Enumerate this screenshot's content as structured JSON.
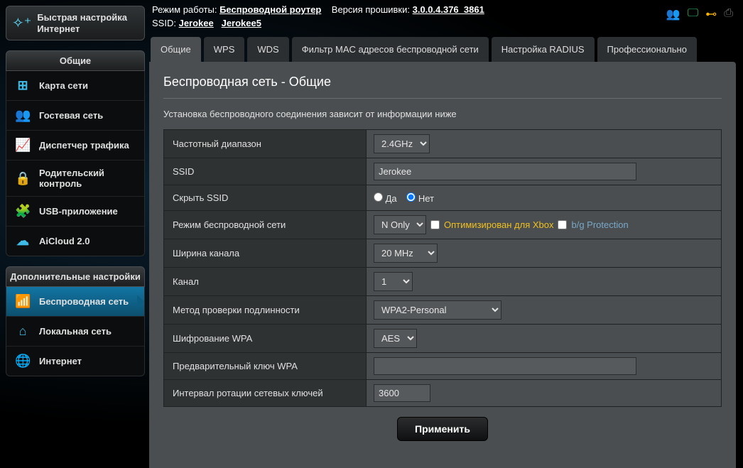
{
  "topbar": {
    "mode_label": "Режим работы:",
    "mode_value": "Беспроводной роутер",
    "fw_label": "Версия прошивки:",
    "fw_value": "3.0.0.4.376_3861",
    "ssid_label": "SSID:",
    "ssid1": "Jerokee",
    "ssid2": "Jerokee5"
  },
  "quick_setup": "Быстрая настройка Интернет",
  "section_general": "Общие",
  "nav_general": [
    {
      "icon": "map",
      "label": "Карта сети"
    },
    {
      "icon": "guests",
      "label": "Гостевая сеть"
    },
    {
      "icon": "traffic",
      "label": "Диспетчер трафика"
    },
    {
      "icon": "lock",
      "label": "Родительский контроль"
    },
    {
      "icon": "puzzle",
      "label": "USB-приложение"
    },
    {
      "icon": "cloud",
      "label": "AiCloud 2.0"
    }
  ],
  "section_advanced": "Дополнительные настройки",
  "nav_advanced": [
    {
      "icon": "wifi",
      "label": "Беспроводная сеть",
      "active": true
    },
    {
      "icon": "home",
      "label": "Локальная сеть"
    },
    {
      "icon": "globe",
      "label": "Интернет"
    }
  ],
  "tabs": [
    {
      "label": "Общие",
      "active": true
    },
    {
      "label": "WPS"
    },
    {
      "label": "WDS"
    },
    {
      "label": "Фильтр MAC адресов беспроводной сети"
    },
    {
      "label": "Настройка RADIUS"
    },
    {
      "label": "Профессионально"
    }
  ],
  "panel": {
    "title": "Беспроводная сеть - Общие",
    "desc": "Установка беспроводного соединения зависит от информации ниже"
  },
  "form": {
    "band_label": "Частотный диапазон",
    "band_value": "2.4GHz",
    "ssid_label": "SSID",
    "ssid_value": "Jerokee",
    "hide_label": "Скрыть SSID",
    "hide_yes": "Да",
    "hide_no": "Нет",
    "mode_label": "Режим беспроводной сети",
    "mode_value": "N Only",
    "xbox_label": "Оптимизирован для Xbox",
    "bg_label": "b/g Protection",
    "chwidth_label": "Ширина канала",
    "chwidth_value": "20 MHz",
    "channel_label": "Канал",
    "channel_value": "1",
    "auth_label": "Метод проверки подлинности",
    "auth_value": "WPA2-Personal",
    "enc_label": "Шифрование WPA",
    "enc_value": "AES",
    "psk_label": "Предварительный ключ WPA",
    "psk_value": "",
    "rekey_label": "Интервал ротации сетевых ключей",
    "rekey_value": "3600"
  },
  "apply": "Применить"
}
